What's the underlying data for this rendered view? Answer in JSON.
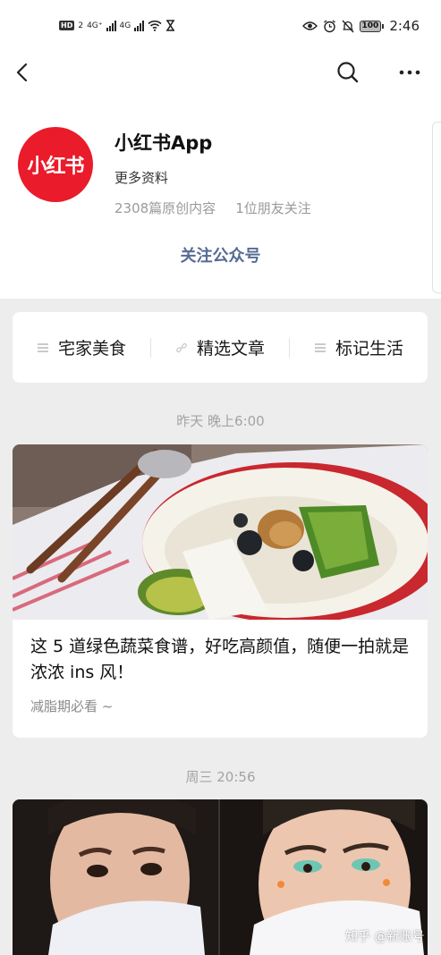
{
  "status_bar": {
    "net_left": "HD",
    "net_left_sub": "2",
    "net1": "4G⁺",
    "net2": "4G",
    "battery": "100",
    "time": "2:46"
  },
  "account": {
    "avatar_text": "小红书",
    "name": "小红书App",
    "more_info": "更多资料",
    "articles_count": "2308篇原创内容",
    "friends_following": "1位朋友关注",
    "follow_button": "关注公众号"
  },
  "menu": [
    {
      "label": "宅家美食",
      "icon": "list-icon"
    },
    {
      "label": "精选文章",
      "icon": "link-icon"
    },
    {
      "label": "标记生活",
      "icon": "list-icon"
    }
  ],
  "feed": [
    {
      "time": "昨天 晚上6:00",
      "title": "这 5 道绿色蔬菜食谱，好吃高颜值，随便一拍就是浓浓 ins 风！",
      "digest": "减脂期必看 ~"
    },
    {
      "time": "周三 20:56"
    }
  ],
  "watermark": "知乎 @新账号",
  "colors": {
    "brand": "#ea1b2b",
    "link": "#576b95",
    "background": "#ededed"
  }
}
